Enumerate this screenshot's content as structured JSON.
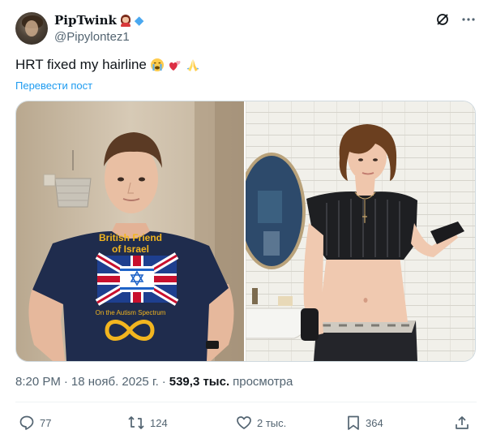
{
  "author": {
    "display_name": "PipTwink",
    "handle": "@Pipylontez1",
    "badge_icons": [
      "woman-emoji",
      "gem-emoji"
    ]
  },
  "header_icons": [
    "grok-icon",
    "more-icon"
  ],
  "tweet": {
    "text": "HRT fixed my hairline",
    "emojis": [
      "loudly-crying-face",
      "two-hearts",
      "folded-hands"
    ],
    "translate_label": "Перевести пост"
  },
  "meta": {
    "time": "8:20 PM",
    "separator": "·",
    "date": "18 нояб. 2025 г.",
    "separator2": "·",
    "views_count": "539,3 тыс.",
    "views_label": "просмотра"
  },
  "actions": {
    "replies": "77",
    "reposts": "124",
    "likes": "2 тыс.",
    "bookmarks": "364"
  },
  "media": {
    "left_shirt": {
      "line1": "British Friend",
      "line2": "of Israel",
      "line3": "On the Autism Spectrum"
    }
  },
  "colors": {
    "link": "#1d9bf0",
    "muted": "#536471",
    "text": "#0f1419",
    "shirt": "#1f2c4d",
    "shirt_text": "#f2b51f"
  }
}
